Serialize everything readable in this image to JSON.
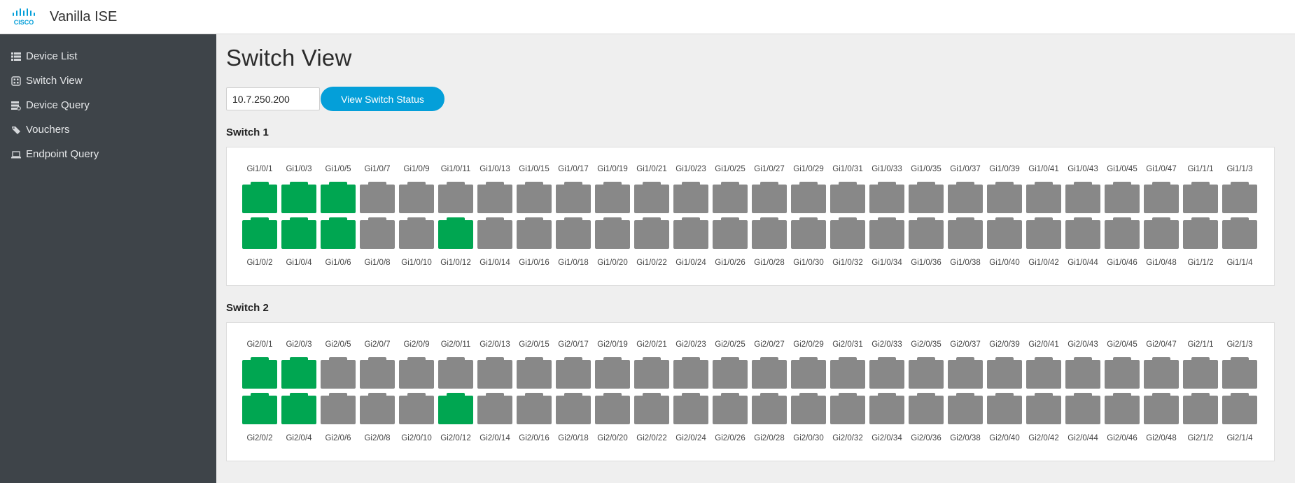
{
  "app": {
    "title": "Vanilla ISE",
    "logo_text": "CISCO"
  },
  "colors": {
    "port_up": "#00a651",
    "port_down": "#888888",
    "accent": "#049fd9",
    "sidebar_bg": "#3e4449"
  },
  "sidebar": {
    "items": [
      {
        "label": "Device List",
        "icon": "list-icon"
      },
      {
        "label": "Switch View",
        "icon": "switch-icon"
      },
      {
        "label": "Device Query",
        "icon": "query-icon"
      },
      {
        "label": "Vouchers",
        "icon": "tag-icon"
      },
      {
        "label": "Endpoint Query",
        "icon": "laptop-icon"
      }
    ]
  },
  "main": {
    "title": "Switch View",
    "ip_input_value": "10.7.250.200",
    "view_button_label": "View Switch Status"
  },
  "switches": [
    {
      "name": "Switch 1",
      "columns": [
        {
          "top": "Gi1/0/1",
          "top_up": true,
          "bottom": "Gi1/0/2",
          "bottom_up": true
        },
        {
          "top": "Gi1/0/3",
          "top_up": true,
          "bottom": "Gi1/0/4",
          "bottom_up": true
        },
        {
          "top": "Gi1/0/5",
          "top_up": true,
          "bottom": "Gi1/0/6",
          "bottom_up": true
        },
        {
          "top": "Gi1/0/7",
          "top_up": false,
          "bottom": "Gi1/0/8",
          "bottom_up": false
        },
        {
          "top": "Gi1/0/9",
          "top_up": false,
          "bottom": "Gi1/0/10",
          "bottom_up": false
        },
        {
          "top": "Gi1/0/11",
          "top_up": false,
          "bottom": "Gi1/0/12",
          "bottom_up": true
        },
        {
          "top": "Gi1/0/13",
          "top_up": false,
          "bottom": "Gi1/0/14",
          "bottom_up": false
        },
        {
          "top": "Gi1/0/15",
          "top_up": false,
          "bottom": "Gi1/0/16",
          "bottom_up": false
        },
        {
          "top": "Gi1/0/17",
          "top_up": false,
          "bottom": "Gi1/0/18",
          "bottom_up": false
        },
        {
          "top": "Gi1/0/19",
          "top_up": false,
          "bottom": "Gi1/0/20",
          "bottom_up": false
        },
        {
          "top": "Gi1/0/21",
          "top_up": false,
          "bottom": "Gi1/0/22",
          "bottom_up": false
        },
        {
          "top": "Gi1/0/23",
          "top_up": false,
          "bottom": "Gi1/0/24",
          "bottom_up": false
        },
        {
          "top": "Gi1/0/25",
          "top_up": false,
          "bottom": "Gi1/0/26",
          "bottom_up": false
        },
        {
          "top": "Gi1/0/27",
          "top_up": false,
          "bottom": "Gi1/0/28",
          "bottom_up": false
        },
        {
          "top": "Gi1/0/29",
          "top_up": false,
          "bottom": "Gi1/0/30",
          "bottom_up": false
        },
        {
          "top": "Gi1/0/31",
          "top_up": false,
          "bottom": "Gi1/0/32",
          "bottom_up": false
        },
        {
          "top": "Gi1/0/33",
          "top_up": false,
          "bottom": "Gi1/0/34",
          "bottom_up": false
        },
        {
          "top": "Gi1/0/35",
          "top_up": false,
          "bottom": "Gi1/0/36",
          "bottom_up": false
        },
        {
          "top": "Gi1/0/37",
          "top_up": false,
          "bottom": "Gi1/0/38",
          "bottom_up": false
        },
        {
          "top": "Gi1/0/39",
          "top_up": false,
          "bottom": "Gi1/0/40",
          "bottom_up": false
        },
        {
          "top": "Gi1/0/41",
          "top_up": false,
          "bottom": "Gi1/0/42",
          "bottom_up": false
        },
        {
          "top": "Gi1/0/43",
          "top_up": false,
          "bottom": "Gi1/0/44",
          "bottom_up": false
        },
        {
          "top": "Gi1/0/45",
          "top_up": false,
          "bottom": "Gi1/0/46",
          "bottom_up": false
        },
        {
          "top": "Gi1/0/47",
          "top_up": false,
          "bottom": "Gi1/0/48",
          "bottom_up": false
        },
        {
          "top": "Gi1/1/1",
          "top_up": false,
          "bottom": "Gi1/1/2",
          "bottom_up": false
        },
        {
          "top": "Gi1/1/3",
          "top_up": false,
          "bottom": "Gi1/1/4",
          "bottom_up": false
        }
      ]
    },
    {
      "name": "Switch 2",
      "columns": [
        {
          "top": "Gi2/0/1",
          "top_up": true,
          "bottom": "Gi2/0/2",
          "bottom_up": true
        },
        {
          "top": "Gi2/0/3",
          "top_up": true,
          "bottom": "Gi2/0/4",
          "bottom_up": true
        },
        {
          "top": "Gi2/0/5",
          "top_up": false,
          "bottom": "Gi2/0/6",
          "bottom_up": false
        },
        {
          "top": "Gi2/0/7",
          "top_up": false,
          "bottom": "Gi2/0/8",
          "bottom_up": false
        },
        {
          "top": "Gi2/0/9",
          "top_up": false,
          "bottom": "Gi2/0/10",
          "bottom_up": false
        },
        {
          "top": "Gi2/0/11",
          "top_up": false,
          "bottom": "Gi2/0/12",
          "bottom_up": true
        },
        {
          "top": "Gi2/0/13",
          "top_up": false,
          "bottom": "Gi2/0/14",
          "bottom_up": false
        },
        {
          "top": "Gi2/0/15",
          "top_up": false,
          "bottom": "Gi2/0/16",
          "bottom_up": false
        },
        {
          "top": "Gi2/0/17",
          "top_up": false,
          "bottom": "Gi2/0/18",
          "bottom_up": false
        },
        {
          "top": "Gi2/0/19",
          "top_up": false,
          "bottom": "Gi2/0/20",
          "bottom_up": false
        },
        {
          "top": "Gi2/0/21",
          "top_up": false,
          "bottom": "Gi2/0/22",
          "bottom_up": false
        },
        {
          "top": "Gi2/0/23",
          "top_up": false,
          "bottom": "Gi2/0/24",
          "bottom_up": false
        },
        {
          "top": "Gi2/0/25",
          "top_up": false,
          "bottom": "Gi2/0/26",
          "bottom_up": false
        },
        {
          "top": "Gi2/0/27",
          "top_up": false,
          "bottom": "Gi2/0/28",
          "bottom_up": false
        },
        {
          "top": "Gi2/0/29",
          "top_up": false,
          "bottom": "Gi2/0/30",
          "bottom_up": false
        },
        {
          "top": "Gi2/0/31",
          "top_up": false,
          "bottom": "Gi2/0/32",
          "bottom_up": false
        },
        {
          "top": "Gi2/0/33",
          "top_up": false,
          "bottom": "Gi2/0/34",
          "bottom_up": false
        },
        {
          "top": "Gi2/0/35",
          "top_up": false,
          "bottom": "Gi2/0/36",
          "bottom_up": false
        },
        {
          "top": "Gi2/0/37",
          "top_up": false,
          "bottom": "Gi2/0/38",
          "bottom_up": false
        },
        {
          "top": "Gi2/0/39",
          "top_up": false,
          "bottom": "Gi2/0/40",
          "bottom_up": false
        },
        {
          "top": "Gi2/0/41",
          "top_up": false,
          "bottom": "Gi2/0/42",
          "bottom_up": false
        },
        {
          "top": "Gi2/0/43",
          "top_up": false,
          "bottom": "Gi2/0/44",
          "bottom_up": false
        },
        {
          "top": "Gi2/0/45",
          "top_up": false,
          "bottom": "Gi2/0/46",
          "bottom_up": false
        },
        {
          "top": "Gi2/0/47",
          "top_up": false,
          "bottom": "Gi2/0/48",
          "bottom_up": false
        },
        {
          "top": "Gi2/1/1",
          "top_up": false,
          "bottom": "Gi2/1/2",
          "bottom_up": false
        },
        {
          "top": "Gi2/1/3",
          "top_up": false,
          "bottom": "Gi2/1/4",
          "bottom_up": false
        }
      ]
    }
  ]
}
